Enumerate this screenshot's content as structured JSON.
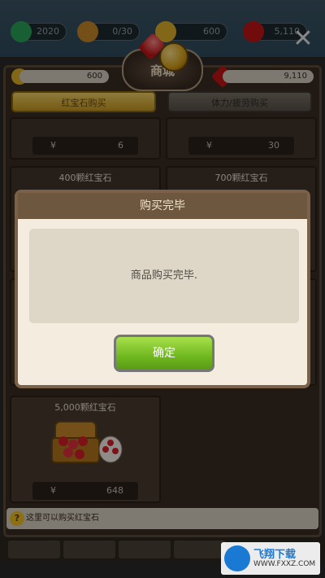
{
  "resources": {
    "items": [
      {
        "icon": "potion-icon",
        "value": "2020",
        "color": "#2aa55b"
      },
      {
        "icon": "hammer-icon",
        "value": "0/30",
        "color": "#c98a2a"
      },
      {
        "icon": "coin-icon",
        "value": "600",
        "color": "#e0b12b"
      },
      {
        "icon": "ruby-icon",
        "value": "5,110",
        "color": "#c41616"
      }
    ]
  },
  "close_icon": "close-icon",
  "shop": {
    "title": "商城",
    "coin_balance": "600",
    "ruby_balance": "9,110",
    "tabs": [
      {
        "label": "红宝石购买",
        "active": true
      },
      {
        "label": "体力/疲劳购买",
        "active": false
      }
    ],
    "products": [
      {
        "title": "",
        "currency": "¥",
        "price": "6"
      },
      {
        "title": "",
        "currency": "¥",
        "price": "30"
      },
      {
        "title": "400颗红宝石",
        "currency": "",
        "price": ""
      },
      {
        "title": "700颗红宝石",
        "currency": "",
        "price": ""
      },
      {
        "title": "5,000颗红宝石",
        "currency": "¥",
        "price": "648"
      }
    ],
    "hint": "这里可以购买红宝石",
    "hint_icon": "?"
  },
  "modal": {
    "title": "购买完毕",
    "message": "商品购买完毕.",
    "ok_label": "确定"
  },
  "watermark": {
    "brand": "飞翔下载",
    "url": "WWW.FXXZ.COM"
  }
}
